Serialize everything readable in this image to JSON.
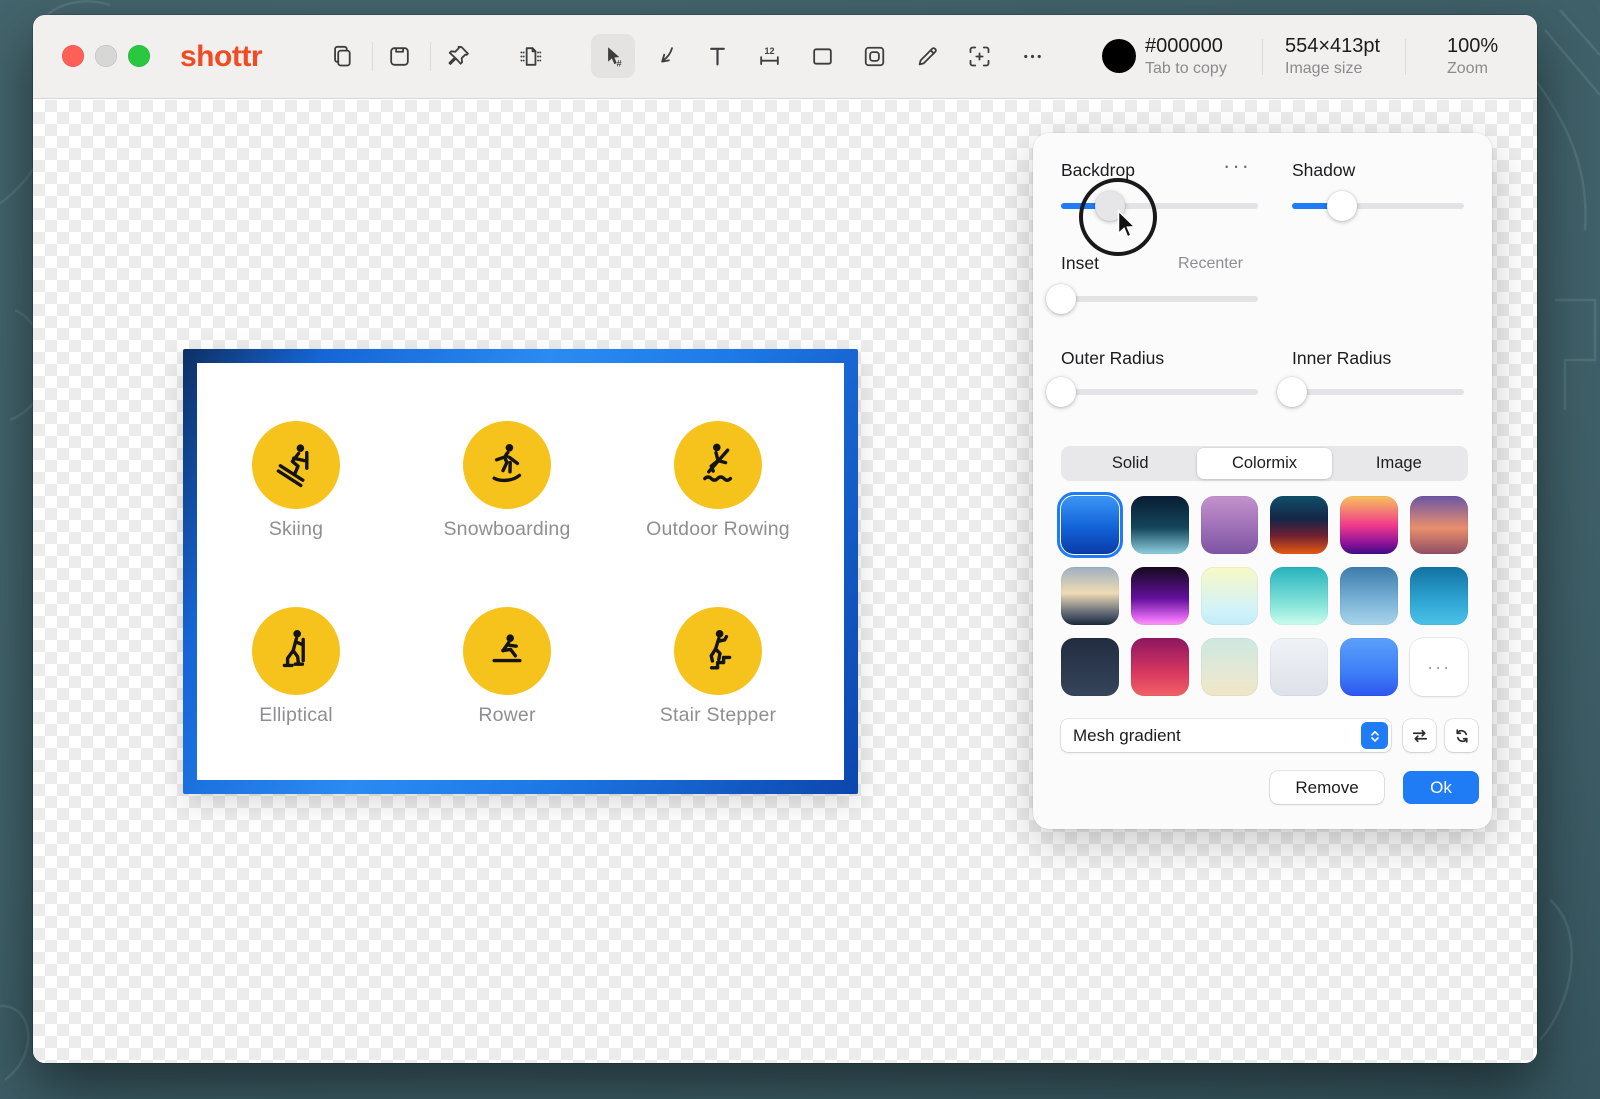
{
  "colors": {
    "accent": "#1f7cf5",
    "logo": "#f04b23",
    "activity_circle": "#f6c31c",
    "desktop": "#41626b"
  },
  "chrome": {
    "app_name": "shottr",
    "traffic_lights": [
      {
        "name": "close",
        "css": "background:#ff5f57"
      },
      {
        "name": "minimize",
        "css": "background:#d7d7d5"
      },
      {
        "name": "zoom",
        "css": "background:#2ac83f"
      }
    ]
  },
  "toolbar": {
    "tools": [
      {
        "icon": "copy-icon"
      },
      {
        "icon": "save-icon"
      },
      {
        "icon": "pin-icon"
      },
      {
        "icon": "backdrop-page-icon"
      },
      {
        "icon": "select-cursor-icon",
        "selected": true
      },
      {
        "icon": "arrow-tool-icon"
      },
      {
        "icon": "text-tool-icon"
      },
      {
        "icon": "measure-tool-icon"
      },
      {
        "icon": "rectangle-tool-icon"
      },
      {
        "icon": "frame-tool-icon"
      },
      {
        "icon": "pencil-tool-icon"
      },
      {
        "icon": "crop-tool-icon"
      },
      {
        "icon": "more-tools-icon"
      }
    ],
    "color_indicator": {
      "swatch_css": "background:#000000",
      "hex": "#000000",
      "hint": "Tab to copy"
    },
    "image_size": {
      "value": "554×413pt",
      "label": "Image size"
    },
    "zoom": {
      "value": "100%",
      "label": "Zoom"
    }
  },
  "canvas": {
    "activities": [
      {
        "label": "Skiing"
      },
      {
        "label": "Snowboarding"
      },
      {
        "label": "Outdoor Rowing"
      },
      {
        "label": "Elliptical"
      },
      {
        "label": "Rower"
      },
      {
        "label": "Stair Stepper"
      }
    ]
  },
  "panel": {
    "backdrop_label": "Backdrop",
    "backdrop_pct": 25,
    "menu_dots": "···",
    "shadow_label": "Shadow",
    "shadow_pct": 29,
    "inset_label": "Inset",
    "inset_pct": 0,
    "recenter_label": "Recenter",
    "outer_radius_label": "Outer Radius",
    "outer_radius_pct": 0,
    "inner_radius_label": "Inner Radius",
    "inner_radius_pct": 0,
    "tabs": [
      {
        "label": "Solid"
      },
      {
        "label": "Colormix",
        "selected": true
      },
      {
        "label": "Image"
      }
    ],
    "swatches": [
      {
        "css": "background:linear-gradient(180deg,#3b96f5 0%,#1262d8 55%,#0a3ba6 100%)",
        "selected": true
      },
      {
        "css": "background:linear-gradient(180deg,#081d33 0%,#14465c 55%,#8ed0e0 100%)"
      },
      {
        "css": "background:linear-gradient(180deg,#c493cc 0%,#9a6cb4 60%,#7e55a4 100%)"
      },
      {
        "css": "background:linear-gradient(180deg,#0f4f68 0%,#152647 40%,#6e1f33 68%,#e85c12 100%)"
      },
      {
        "css": "background:linear-gradient(180deg,#f7c35c 0%,#f23b8a 50%,#8c1198 82%,#3c0f86 100%)"
      },
      {
        "css": "background:linear-gradient(180deg,#6b55a4 0%,#e98f6d 55%,#8f4e63 100%)"
      },
      {
        "css": "background:linear-gradient(180deg,#9eafc2 0%,#eedcb4 45%,#566070 82%,#1b2838 100%)"
      },
      {
        "css": "background:linear-gradient(180deg,#150a1c 0%,#64109f 55%,#e86ef5 90%,#fa9bf2 100%)"
      },
      {
        "css": "background:linear-gradient(180deg,#f9f9c4 0%,#d4f3f7 70%,#c2ecf9 100%)"
      },
      {
        "css": "background:linear-gradient(180deg,#27b3bd 0%,#8fe8dc 70%,#ccfcee 100%)"
      },
      {
        "css": "background:linear-gradient(180deg,#3c7cab 0%,#7db4d8 60%,#a9d4ea 100%)"
      },
      {
        "css": "background:linear-gradient(180deg,#1272a2 0%,#2fa6d4 60%,#4cc2e8 100%)"
      },
      {
        "css": "background:linear-gradient(180deg,#222c40 0%,#36455a 100%)"
      },
      {
        "css": "background:linear-gradient(180deg,#8c1660 0%,#d8385f 60%,#f26168 100%)"
      },
      {
        "css": "background:linear-gradient(180deg,#cde8e2 0%,#e8e8d2 70%,#efe5c4 100%)"
      },
      {
        "css": "background:linear-gradient(180deg,#f0f2f6 0%,#dde1e9 100%)"
      },
      {
        "css": "background:linear-gradient(180deg,#5ba0fb 0%,#3e7ef7 60%,#2e55ef 100%)"
      },
      {
        "label": "···",
        "name": "more-gradients"
      }
    ],
    "gradient_type": "Mesh gradient",
    "remove_label": "Remove",
    "ok_label": "Ok"
  }
}
